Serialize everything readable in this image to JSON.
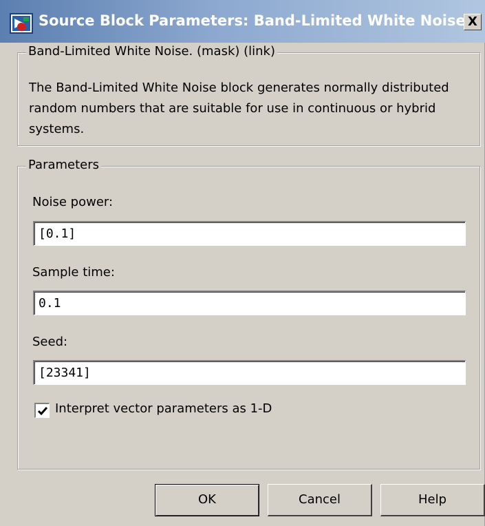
{
  "window": {
    "title": "Source Block Parameters: Band-Limited White Noise",
    "close_label": "X",
    "title_icon": "simulink-block-icon"
  },
  "description": {
    "legend": "Band-Limited White Noise. (mask) (link)",
    "text": "The Band-Limited White Noise block generates normally distributed random numbers that are suitable for use in continuous or hybrid systems."
  },
  "parameters": {
    "legend": "Parameters",
    "noise_power": {
      "label": "Noise power:",
      "value": "[0.1]"
    },
    "sample_time": {
      "label": "Sample time:",
      "value": "0.1"
    },
    "seed": {
      "label": "Seed:",
      "value": "[23341]"
    },
    "interpret_vector": {
      "label": "Interpret vector parameters as 1-D",
      "checked": true
    }
  },
  "buttons": {
    "ok": "OK",
    "cancel": "Cancel",
    "help": "Help"
  }
}
